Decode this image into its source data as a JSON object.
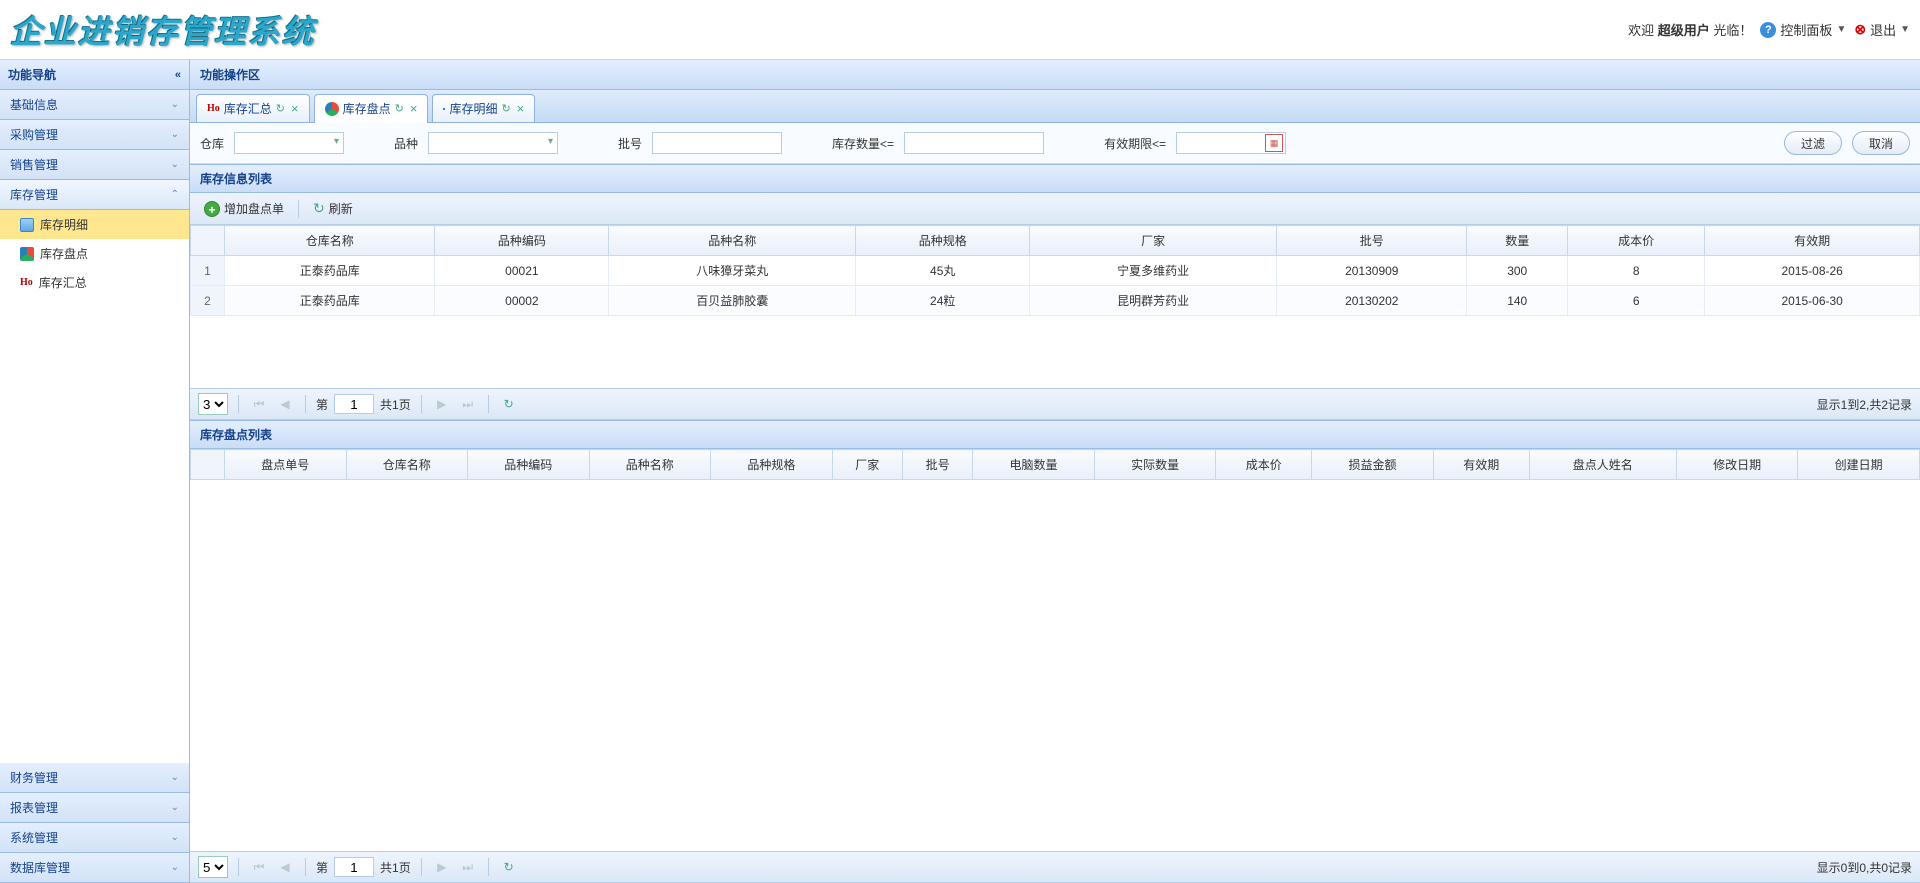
{
  "header": {
    "logo": "企业进销存管理系统",
    "welcome_prefix": "欢迎 ",
    "welcome_user": "超级用户",
    "welcome_suffix": " 光临！",
    "control_panel": "控制面板",
    "exit": "退出"
  },
  "sidebar": {
    "title": "功能导航",
    "groups": {
      "basic": "基础信息",
      "purchase": "采购管理",
      "sales": "销售管理",
      "inventory": "库存管理",
      "finance": "财务管理",
      "report": "报表管理",
      "system": "系统管理",
      "database": "数据库管理"
    },
    "inventory_items": {
      "detail": "库存明细",
      "check": "库存盘点",
      "summary": "库存汇总"
    }
  },
  "content": {
    "title": "功能操作区"
  },
  "tabs": {
    "summary": "库存汇总",
    "check": "库存盘点",
    "detail": "库存明细"
  },
  "filter": {
    "warehouse": "仓库",
    "variety": "品种",
    "batch": "批号",
    "qty_lte": "库存数量<=",
    "expire_lte": "有效期限<=",
    "filter_btn": "过滤",
    "cancel_btn": "取消"
  },
  "panel1": {
    "title": "库存信息列表",
    "toolbar": {
      "add": "增加盘点单",
      "refresh": "刷新"
    },
    "columns": {
      "warehouse": "仓库名称",
      "variety_code": "品种编码",
      "variety_name": "品种名称",
      "spec": "品种规格",
      "manufacturer": "厂家",
      "batch": "批号",
      "qty": "数量",
      "cost": "成本价",
      "expire": "有效期"
    },
    "rows": [
      {
        "warehouse": "正泰药品库",
        "variety_code": "00021",
        "variety_name": "八味獐牙菜丸",
        "spec": "45丸",
        "manufacturer": "宁夏多维药业",
        "batch": "20130909",
        "qty": "300",
        "cost": "8",
        "expire": "2015-08-26"
      },
      {
        "warehouse": "正泰药品库",
        "variety_code": "00002",
        "variety_name": "百贝益肺胶囊",
        "spec": "24粒",
        "manufacturer": "昆明群芳药业",
        "batch": "20130202",
        "qty": "140",
        "cost": "6",
        "expire": "2015-06-30"
      }
    ],
    "paging": {
      "page_size": "3",
      "page_prefix": "第",
      "page_value": "1",
      "page_total": "共1页",
      "info": "显示1到2,共2记录"
    }
  },
  "panel2": {
    "title": "库存盘点列表",
    "columns": {
      "check_no": "盘点单号",
      "warehouse": "仓库名称",
      "variety_code": "品种编码",
      "variety_name": "品种名称",
      "spec": "品种规格",
      "manufacturer": "厂家",
      "batch": "批号",
      "computer_qty": "电脑数量",
      "actual_qty": "实际数量",
      "cost": "成本价",
      "profit_loss": "损益金额",
      "expire": "有效期",
      "checker": "盘点人姓名",
      "modify_date": "修改日期",
      "create_date": "创建日期"
    },
    "paging": {
      "page_size": "5",
      "page_prefix": "第",
      "page_value": "1",
      "page_total": "共1页",
      "info": "显示0到0,共0记录"
    }
  }
}
